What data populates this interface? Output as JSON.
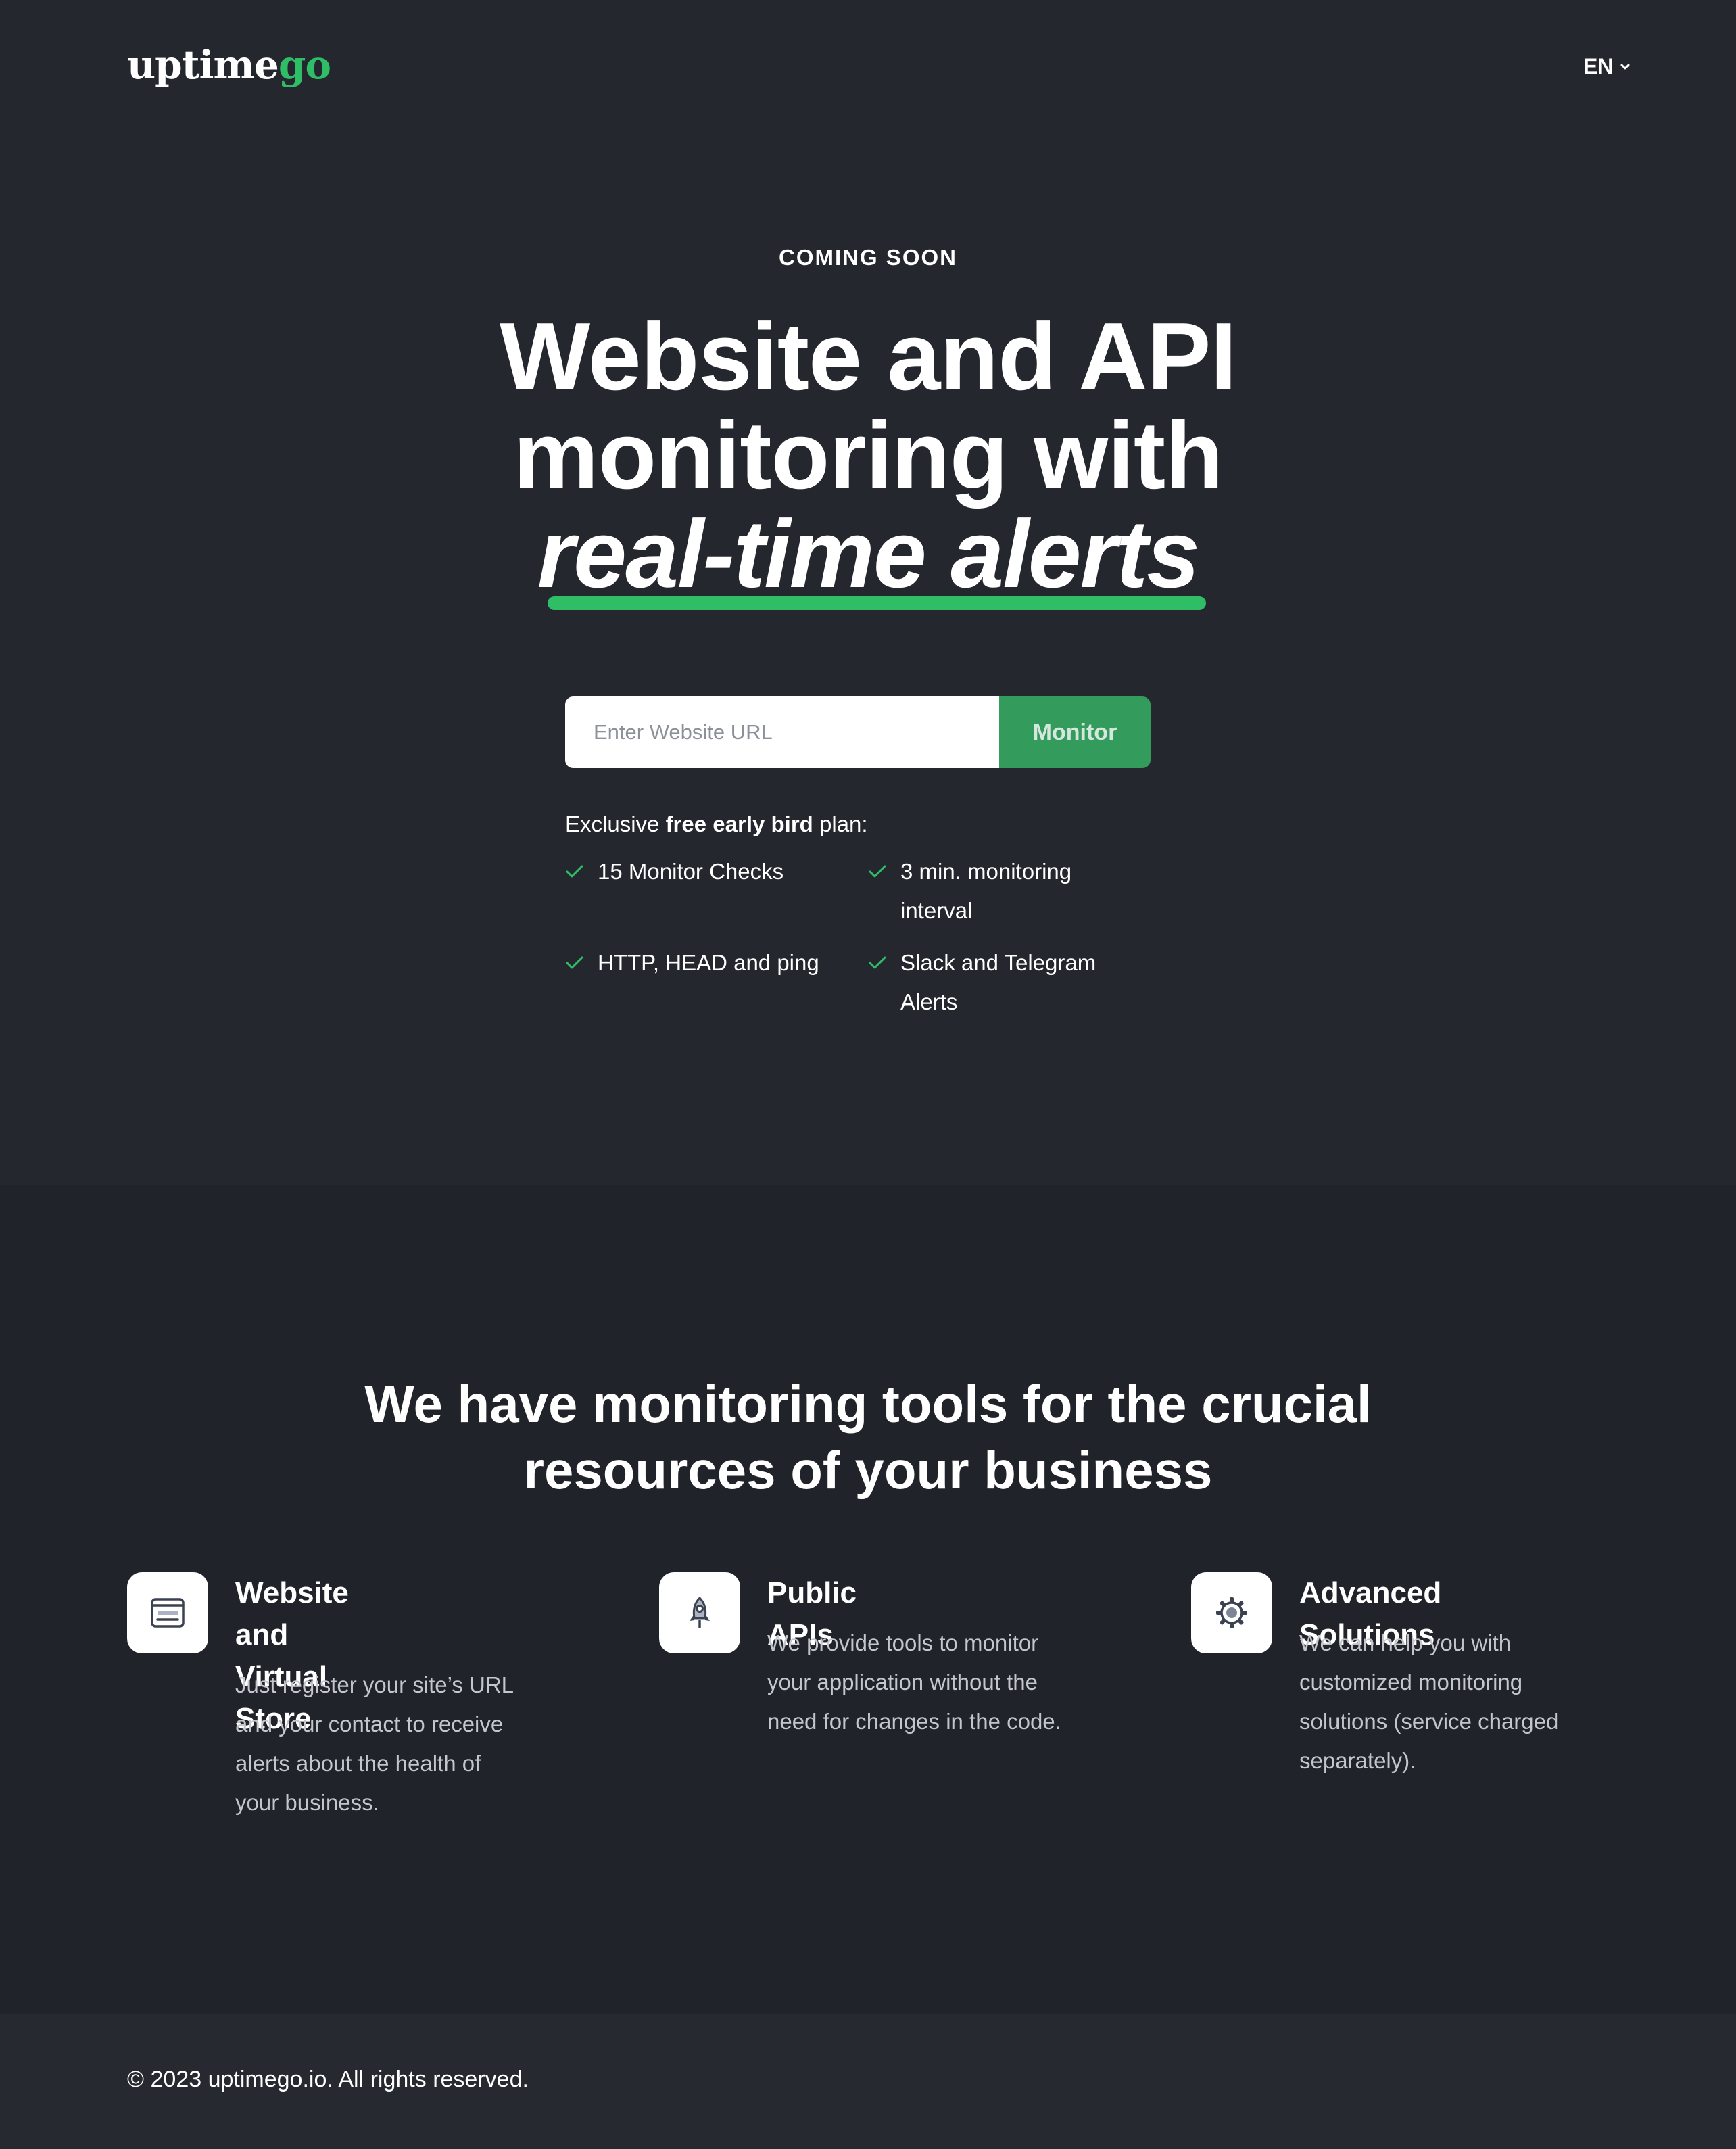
{
  "brand": {
    "name_main": "uptime",
    "name_accent": "go",
    "accent_color": "#2fbd66"
  },
  "nav": {
    "language": "EN"
  },
  "hero": {
    "eyebrow": "COMING SOON",
    "headline_line1": "Website and API",
    "headline_line2": "monitoring with",
    "headline_emphasis": "real-time alerts",
    "url_placeholder": "Enter Website URL",
    "submit_label": "Monitor",
    "plan_prefix": "Exclusive",
    "plan_bold": "free early bird",
    "plan_suffix": "plan:",
    "features": [
      {
        "line1": "15 Monitor Checks",
        "line2": ""
      },
      {
        "line1": "3 min. monitoring",
        "line2": "interval"
      },
      {
        "line1": "HTTP, HEAD and ping",
        "line2": ""
      },
      {
        "line1": "Slack and Telegram",
        "line2": "Alerts"
      }
    ]
  },
  "tools": {
    "title_line1": "We have monitoring tools for the crucial",
    "title_line2": "resources of your business",
    "cards": [
      {
        "icon": "browser-window-icon",
        "title_line1": "Website and Virtual",
        "title_line2": "Store",
        "desc": [
          "Just register your site’s URL",
          "and your contact to receive",
          "alerts about the health of",
          "your business."
        ]
      },
      {
        "icon": "rocket-icon",
        "title_line1": "Public APIs",
        "title_line2": "",
        "desc": [
          "We provide tools to monitor",
          "your application without the",
          "need for changes in the code."
        ]
      },
      {
        "icon": "gear-icon",
        "title_line1": "Advanced Solutions",
        "title_line2": "",
        "desc": [
          "We can help you with",
          "customized monitoring",
          "solutions (service charged",
          "separately)."
        ]
      }
    ]
  },
  "footer": {
    "copyright": "© 2023 uptimego.io. All rights reserved."
  }
}
